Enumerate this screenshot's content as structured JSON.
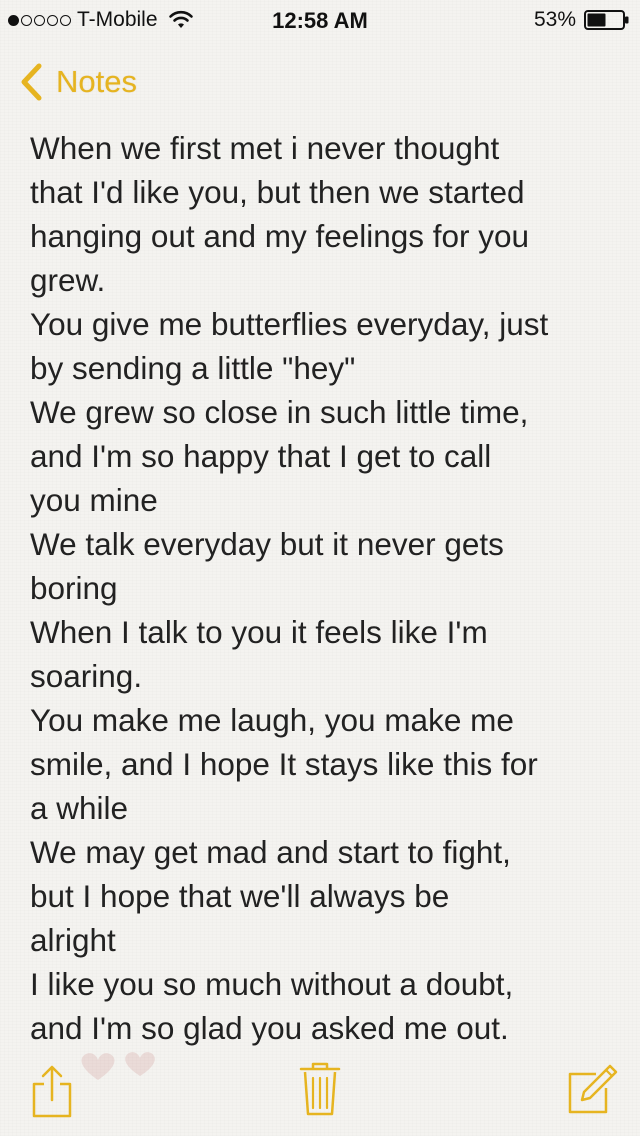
{
  "status_bar": {
    "carrier": "T-Mobile",
    "signal_strength": 1,
    "signal_dots_total": 5,
    "time": "12:58 AM",
    "battery_percent": "53%",
    "battery_level": 0.53
  },
  "nav": {
    "back_label": "Notes"
  },
  "note": {
    "lines": [
      "When we first met i never thought",
      "that I'd like you, but then we started",
      "hanging out and my feelings for you",
      "grew.",
      "You give me butterflies everyday, just",
      "by sending a little \"hey\"",
      "We grew so close in such little time,",
      "and I'm so happy that I get to call",
      "you mine",
      "We talk everyday but it never gets",
      "boring",
      "When I talk to you it feels like I'm",
      "soaring.",
      "You make me laugh, you make me",
      "smile, and I hope It stays like this for",
      "a while",
      "We may get mad and start to fight,",
      "but I hope that we'll always be",
      "alright",
      "I like you so much without a doubt,",
      "and I'm so glad you asked me out."
    ]
  },
  "toolbar": {
    "share_icon": "share-icon",
    "trash_icon": "trash-icon",
    "compose_icon": "compose-icon"
  },
  "colors": {
    "accent": "#e6b420",
    "background": "#f4f3f0",
    "text": "#222222"
  }
}
